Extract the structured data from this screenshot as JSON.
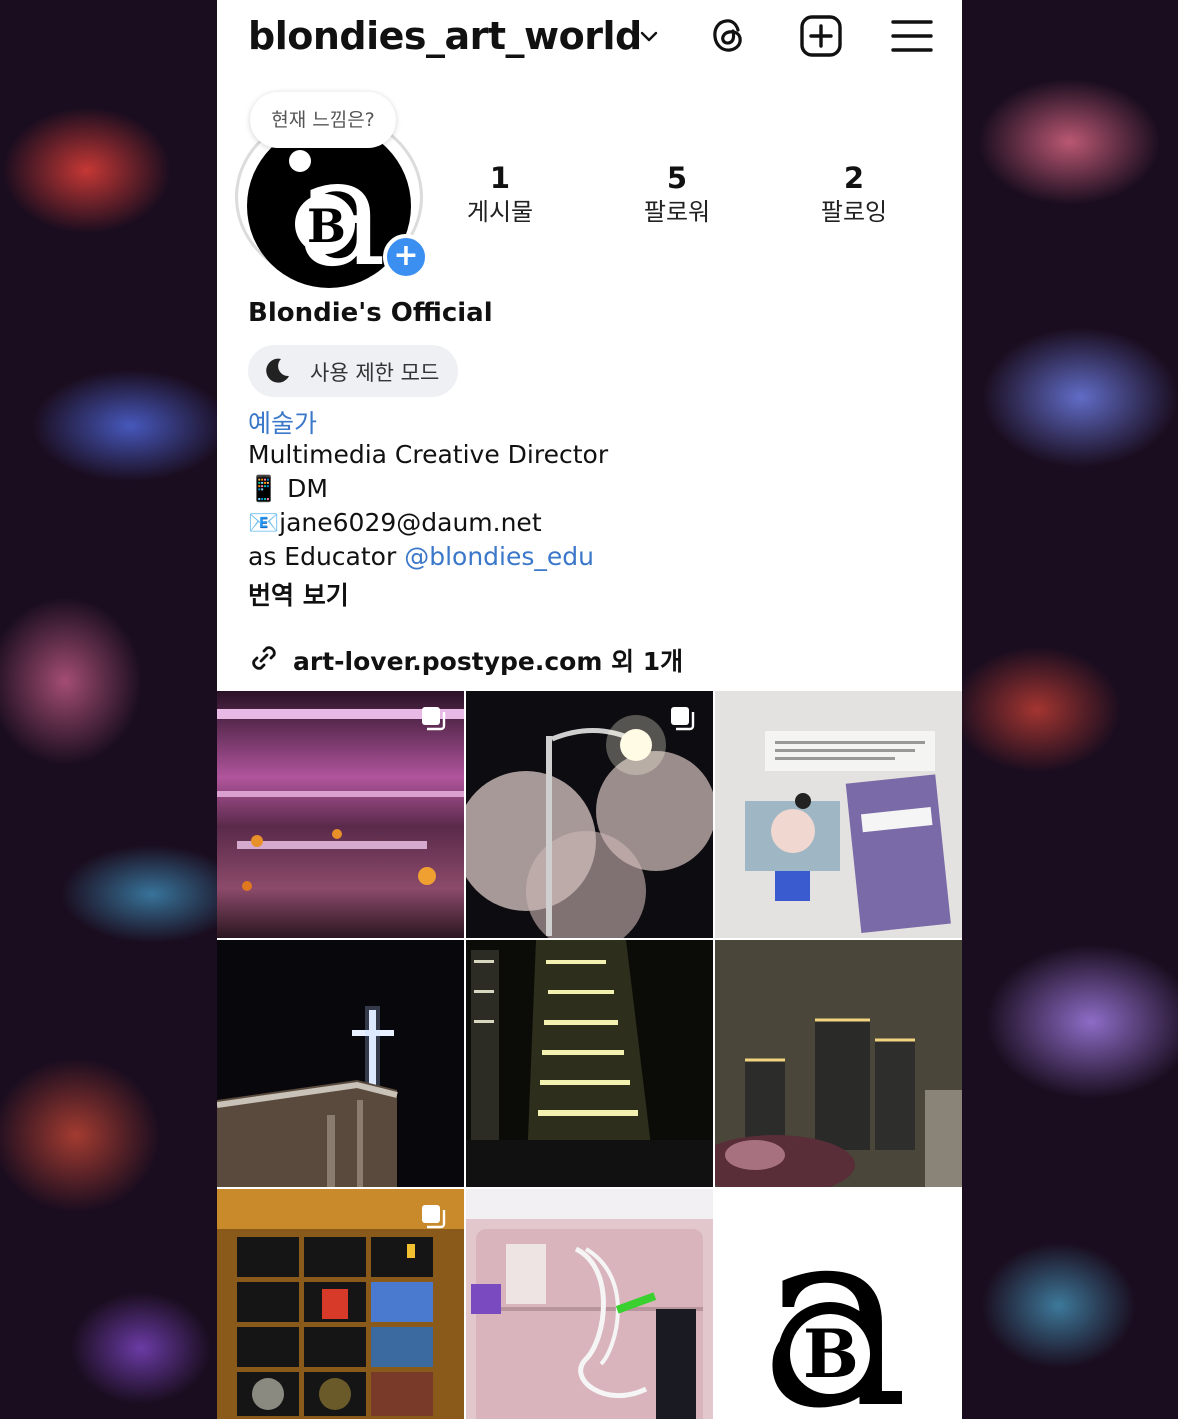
{
  "header": {
    "username": "blondies_art_world"
  },
  "note": {
    "text": "현재 느낌은?"
  },
  "stats": [
    {
      "value": "1",
      "label": "게시물"
    },
    {
      "value": "5",
      "label": "팔로워"
    },
    {
      "value": "2",
      "label": "팔로잉"
    }
  ],
  "profile": {
    "display_name": "Blondie's Official",
    "chip_label": "사용 제한 모드",
    "category": "예술가",
    "bio": {
      "line1": "Multimedia Creative Director",
      "line2_emoji": "📱",
      "line2_text": " DM",
      "line3_emoji": "📧",
      "line3_text": "jane6029@daum.net",
      "line4_prefix": "as Educator ",
      "line4_mention": "@blondies_edu"
    },
    "translate_label": "번역 보기",
    "link_text": "art-lover.postype.com 외 1개"
  },
  "avatar": {
    "glyph_a": "a",
    "glyph_b": "B"
  },
  "posts": [
    {
      "subject": "goldfish tank",
      "multi": true
    },
    {
      "subject": "cherry blossom streetlight",
      "multi": true
    },
    {
      "subject": "scrapbook collage",
      "multi": false
    },
    {
      "subject": "illuminated cross",
      "multi": false
    },
    {
      "subject": "office tower at night",
      "multi": false
    },
    {
      "subject": "foggy apartment towers",
      "multi": false
    },
    {
      "subject": "photo collage grid",
      "multi": true
    },
    {
      "subject": "pink pouch with earphones",
      "multi": false
    },
    {
      "subject": "aB logo",
      "multi": false
    }
  ],
  "colors": {
    "accent": "#3b8ff0",
    "link": "#3b78c9",
    "chip_bg": "#eef0f3"
  }
}
